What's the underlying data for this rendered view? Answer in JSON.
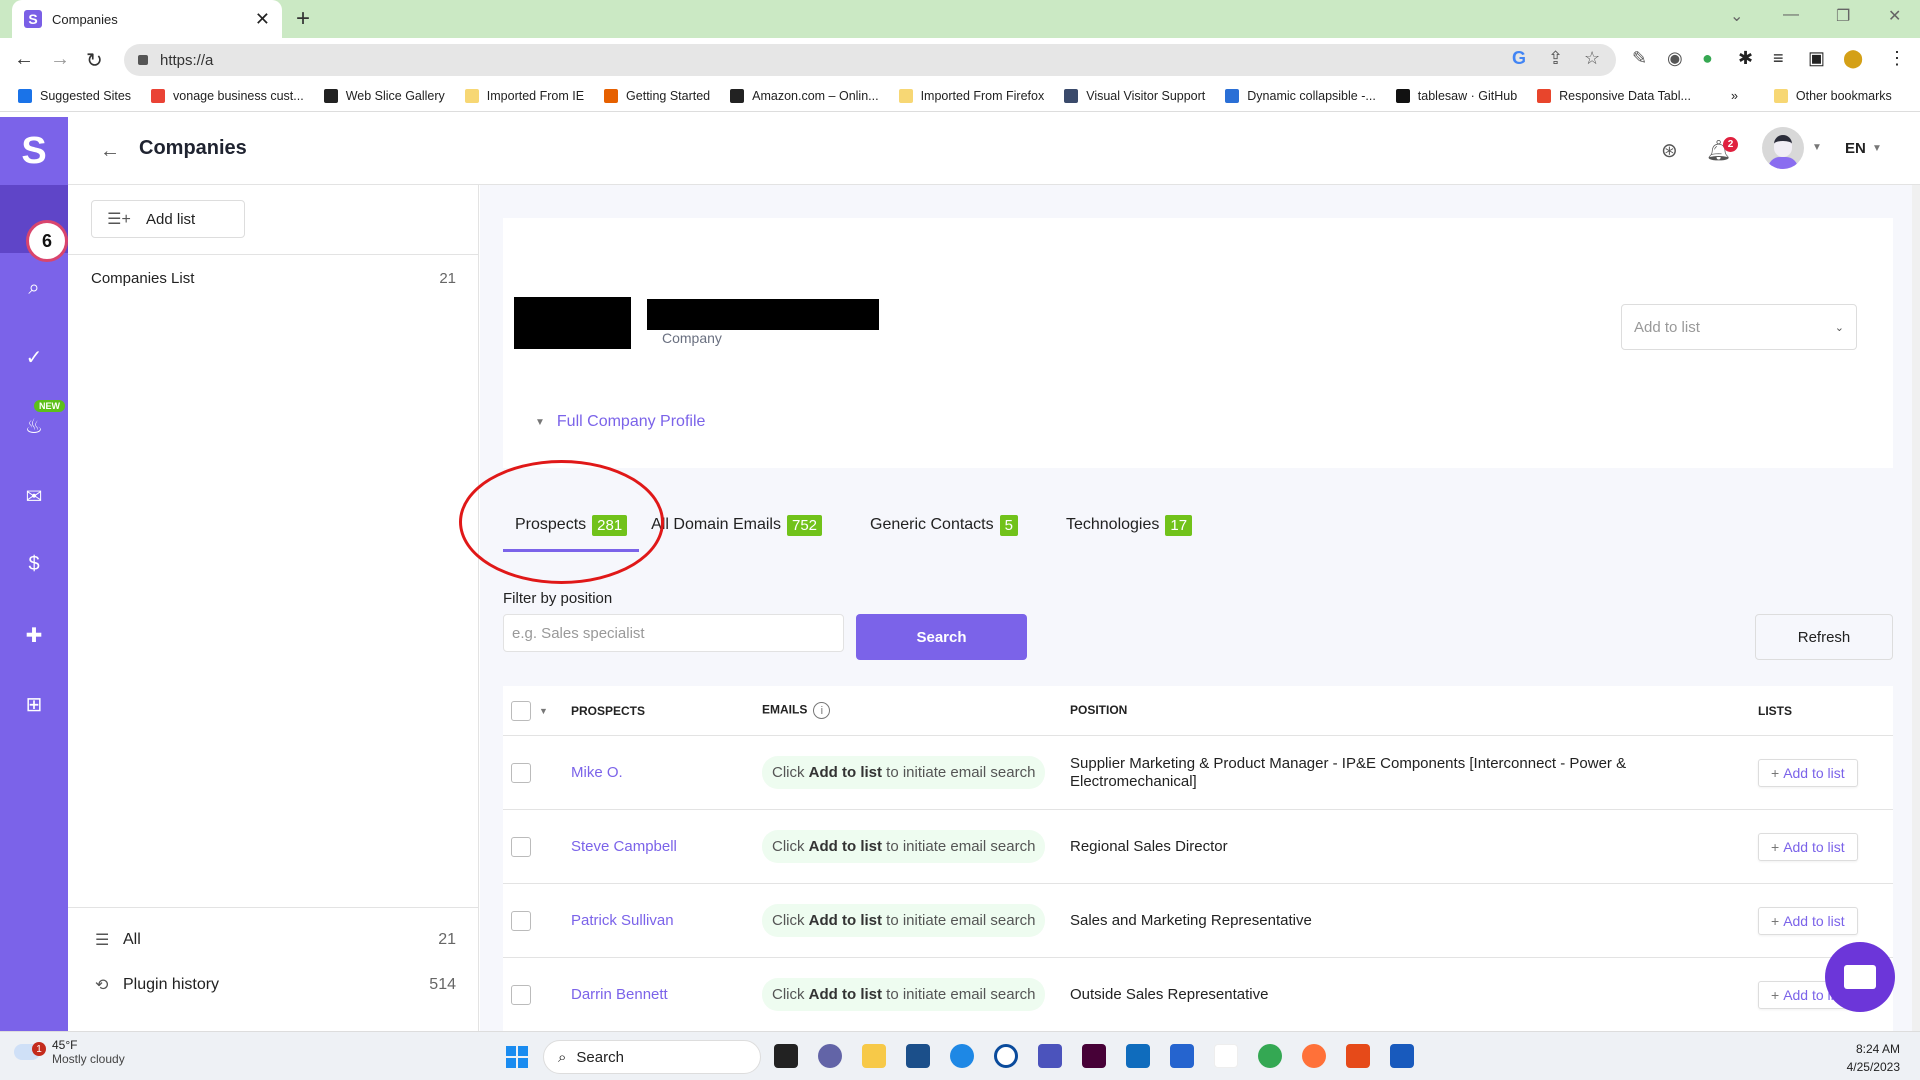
{
  "browser": {
    "tab_title": "Companies",
    "tab_favicon": "S",
    "url": "https://a",
    "bookmarks": [
      {
        "label": "Suggested Sites",
        "icon": "search-icon",
        "color": "#1a73e8"
      },
      {
        "label": "vonage business cust...",
        "icon": "google-icon",
        "color": "#ea4335"
      },
      {
        "label": "Web Slice Gallery",
        "icon": "web-slice-icon",
        "color": "#222222"
      },
      {
        "label": "Imported From IE",
        "icon": "folder-icon",
        "color": "#f7d774"
      },
      {
        "label": "Getting Started",
        "icon": "firefox-icon",
        "color": "#e66000"
      },
      {
        "label": "Amazon.com – Onlin...",
        "icon": "amazon-icon",
        "color": "#222222"
      },
      {
        "label": "Imported From Firefox",
        "icon": "folder-icon",
        "color": "#f7d774"
      },
      {
        "label": "Visual Visitor Support",
        "icon": "k-icon",
        "color": "#3a4a6b"
      },
      {
        "label": "Dynamic collapsible -...",
        "icon": "dynamic-icon",
        "color": "#2a6fd6"
      },
      {
        "label": "tablesaw · GitHub",
        "icon": "github-icon",
        "color": "#111111"
      },
      {
        "label": "Responsive Data Tabl...",
        "icon": "asterisk-icon",
        "color": "#e8452c"
      }
    ],
    "more_bookmarks": "»",
    "other_bookmarks": "Other bookmarks"
  },
  "app": {
    "logo": "S",
    "page_title": "Companies",
    "rail_badge": "6",
    "new_tag": "NEW",
    "notifications_count": "2",
    "language": "EN",
    "accent": "#7b63e9"
  },
  "left_panel": {
    "add_list_label": "Add list",
    "lists": [
      {
        "label": "Companies List",
        "count": "21"
      }
    ],
    "bottom": [
      {
        "label": "All",
        "count": "21"
      },
      {
        "label": "Plugin history",
        "count": "514"
      }
    ]
  },
  "company": {
    "caption": "Company",
    "add_to_list_placeholder": "Add to list",
    "full_profile_label": "Full Company Profile"
  },
  "tabs": [
    {
      "label": "Prospects",
      "count": "281",
      "active": true
    },
    {
      "label": "All Domain Emails",
      "count": "752"
    },
    {
      "label": "Generic Contacts",
      "count": "5"
    },
    {
      "label": "Technologies",
      "count": "17"
    }
  ],
  "filter": {
    "label": "Filter by position",
    "placeholder": "e.g. Sales specialist",
    "value": "",
    "search_label": "Search",
    "refresh_label": "Refresh"
  },
  "table": {
    "headers": {
      "prospects": "PROSPECTS",
      "emails": "EMAILS",
      "position": "POSITION",
      "lists": "LISTS"
    },
    "email_prefix": "Click ",
    "email_bold": "Add to list",
    "email_suffix": " to initiate email search",
    "add_label": "Add to list",
    "rows": [
      {
        "name": "Mike O.",
        "position": "Supplier Marketing & Product Manager - IP&E Components [Interconnect - Power & Electromechanical]"
      },
      {
        "name": "Steve Campbell",
        "position": "Regional Sales Director"
      },
      {
        "name": "Patrick Sullivan",
        "position": "Sales and Marketing Representative"
      },
      {
        "name": "Darrin Bennett",
        "position": "Outside Sales Representative"
      }
    ]
  },
  "taskbar": {
    "weather_temp": "45°F",
    "weather_desc": "Mostly cloudy",
    "weather_badge": "1",
    "search_label": "Search",
    "time": "8:24 AM",
    "date": "4/25/2023"
  }
}
